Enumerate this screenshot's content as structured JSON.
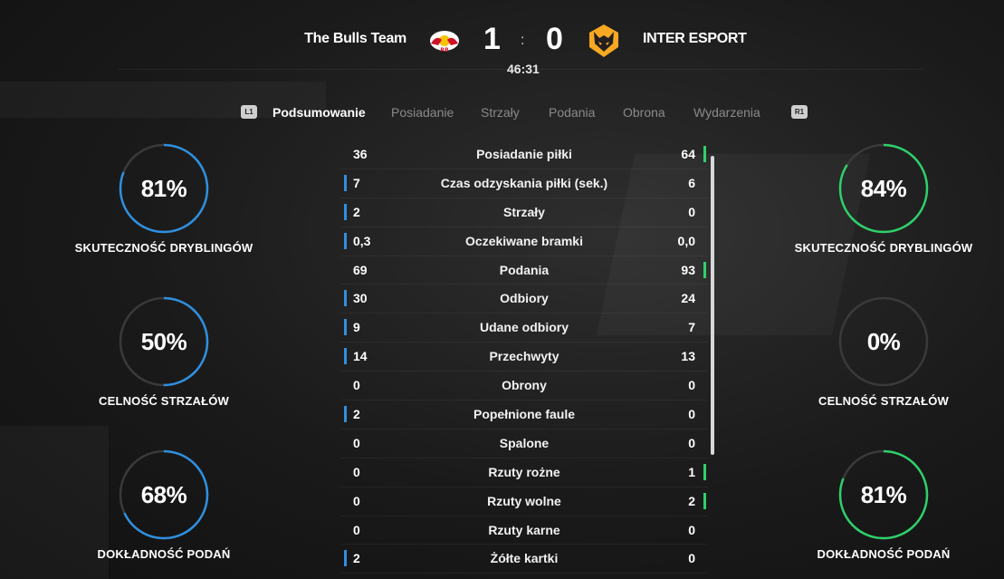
{
  "match": {
    "home_team": "The Bulls Team",
    "away_team": "INTER ESPORT",
    "home_score": "1",
    "separator": ":",
    "away_score": "0",
    "clock": "46:31"
  },
  "tabs": {
    "left_hint": "L1",
    "right_hint": "R1",
    "items": [
      "Podsumowanie",
      "Posiadanie",
      "Strzały",
      "Podania",
      "Obrona",
      "Wydarzenia"
    ],
    "active": "Podsumowanie"
  },
  "rings": {
    "left": [
      {
        "value": "81%",
        "pct": 81,
        "label": "SKUTECZNOŚĆ DRYBLINGÓW"
      },
      {
        "value": "50%",
        "pct": 50,
        "label": "CELNOŚĆ STRZAŁÓW"
      },
      {
        "value": "68%",
        "pct": 68,
        "label": "DOKŁADNOŚĆ PODAŃ"
      }
    ],
    "right": [
      {
        "value": "84%",
        "pct": 84,
        "label": "SKUTECZNOŚĆ DRYBLINGÓW"
      },
      {
        "value": "0%",
        "pct": 0,
        "label": "CELNOŚĆ STRZAŁÓW"
      },
      {
        "value": "81%",
        "pct": 81,
        "label": "DOKŁADNOŚĆ PODAŃ"
      }
    ]
  },
  "stats": [
    {
      "name": "Posiadanie piłki",
      "home": "36",
      "away": "64",
      "leader": "away"
    },
    {
      "name": "Czas odzyskania piłki (sek.)",
      "home": "7",
      "away": "6",
      "leader": "home"
    },
    {
      "name": "Strzały",
      "home": "2",
      "away": "0",
      "leader": "home"
    },
    {
      "name": "Oczekiwane bramki",
      "home": "0,3",
      "away": "0,0",
      "leader": "home"
    },
    {
      "name": "Podania",
      "home": "69",
      "away": "93",
      "leader": "away"
    },
    {
      "name": "Odbiory",
      "home": "30",
      "away": "24",
      "leader": "home"
    },
    {
      "name": "Udane odbiory",
      "home": "9",
      "away": "7",
      "leader": "home"
    },
    {
      "name": "Przechwyty",
      "home": "14",
      "away": "13",
      "leader": "home"
    },
    {
      "name": "Obrony",
      "home": "0",
      "away": "0",
      "leader": "none"
    },
    {
      "name": "Popełnione faule",
      "home": "2",
      "away": "0",
      "leader": "home"
    },
    {
      "name": "Spalone",
      "home": "0",
      "away": "0",
      "leader": "none"
    },
    {
      "name": "Rzuty rożne",
      "home": "0",
      "away": "1",
      "leader": "away"
    },
    {
      "name": "Rzuty wolne",
      "home": "0",
      "away": "2",
      "leader": "away"
    },
    {
      "name": "Rzuty karne",
      "home": "0",
      "away": "0",
      "leader": "none"
    },
    {
      "name": "Żółte kartki",
      "home": "2",
      "away": "0",
      "leader": "home"
    }
  ],
  "colors": {
    "home_accent": "#2f8fe0",
    "away_accent": "#2ed06a",
    "ring_track": "#3a3a3a"
  },
  "icons": {
    "home_crest": "bulls-crest-icon",
    "away_crest": "wolf-crest-icon"
  }
}
